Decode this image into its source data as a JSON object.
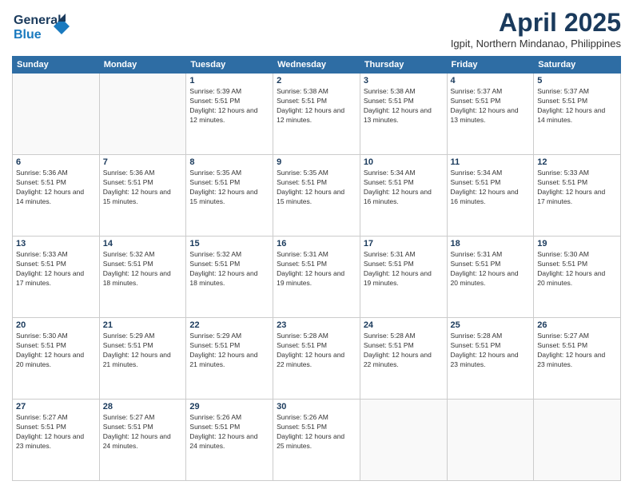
{
  "header": {
    "logo_line1": "General",
    "logo_line2": "Blue",
    "title": "April 2025",
    "subtitle": "Igpit, Northern Mindanao, Philippines"
  },
  "weekdays": [
    "Sunday",
    "Monday",
    "Tuesday",
    "Wednesday",
    "Thursday",
    "Friday",
    "Saturday"
  ],
  "weeks": [
    [
      {
        "day": "",
        "sunrise": "",
        "sunset": "",
        "daylight": ""
      },
      {
        "day": "",
        "sunrise": "",
        "sunset": "",
        "daylight": ""
      },
      {
        "day": "1",
        "sunrise": "Sunrise: 5:39 AM",
        "sunset": "Sunset: 5:51 PM",
        "daylight": "Daylight: 12 hours and 12 minutes."
      },
      {
        "day": "2",
        "sunrise": "Sunrise: 5:38 AM",
        "sunset": "Sunset: 5:51 PM",
        "daylight": "Daylight: 12 hours and 12 minutes."
      },
      {
        "day": "3",
        "sunrise": "Sunrise: 5:38 AM",
        "sunset": "Sunset: 5:51 PM",
        "daylight": "Daylight: 12 hours and 13 minutes."
      },
      {
        "day": "4",
        "sunrise": "Sunrise: 5:37 AM",
        "sunset": "Sunset: 5:51 PM",
        "daylight": "Daylight: 12 hours and 13 minutes."
      },
      {
        "day": "5",
        "sunrise": "Sunrise: 5:37 AM",
        "sunset": "Sunset: 5:51 PM",
        "daylight": "Daylight: 12 hours and 14 minutes."
      }
    ],
    [
      {
        "day": "6",
        "sunrise": "Sunrise: 5:36 AM",
        "sunset": "Sunset: 5:51 PM",
        "daylight": "Daylight: 12 hours and 14 minutes."
      },
      {
        "day": "7",
        "sunrise": "Sunrise: 5:36 AM",
        "sunset": "Sunset: 5:51 PM",
        "daylight": "Daylight: 12 hours and 15 minutes."
      },
      {
        "day": "8",
        "sunrise": "Sunrise: 5:35 AM",
        "sunset": "Sunset: 5:51 PM",
        "daylight": "Daylight: 12 hours and 15 minutes."
      },
      {
        "day": "9",
        "sunrise": "Sunrise: 5:35 AM",
        "sunset": "Sunset: 5:51 PM",
        "daylight": "Daylight: 12 hours and 15 minutes."
      },
      {
        "day": "10",
        "sunrise": "Sunrise: 5:34 AM",
        "sunset": "Sunset: 5:51 PM",
        "daylight": "Daylight: 12 hours and 16 minutes."
      },
      {
        "day": "11",
        "sunrise": "Sunrise: 5:34 AM",
        "sunset": "Sunset: 5:51 PM",
        "daylight": "Daylight: 12 hours and 16 minutes."
      },
      {
        "day": "12",
        "sunrise": "Sunrise: 5:33 AM",
        "sunset": "Sunset: 5:51 PM",
        "daylight": "Daylight: 12 hours and 17 minutes."
      }
    ],
    [
      {
        "day": "13",
        "sunrise": "Sunrise: 5:33 AM",
        "sunset": "Sunset: 5:51 PM",
        "daylight": "Daylight: 12 hours and 17 minutes."
      },
      {
        "day": "14",
        "sunrise": "Sunrise: 5:32 AM",
        "sunset": "Sunset: 5:51 PM",
        "daylight": "Daylight: 12 hours and 18 minutes."
      },
      {
        "day": "15",
        "sunrise": "Sunrise: 5:32 AM",
        "sunset": "Sunset: 5:51 PM",
        "daylight": "Daylight: 12 hours and 18 minutes."
      },
      {
        "day": "16",
        "sunrise": "Sunrise: 5:31 AM",
        "sunset": "Sunset: 5:51 PM",
        "daylight": "Daylight: 12 hours and 19 minutes."
      },
      {
        "day": "17",
        "sunrise": "Sunrise: 5:31 AM",
        "sunset": "Sunset: 5:51 PM",
        "daylight": "Daylight: 12 hours and 19 minutes."
      },
      {
        "day": "18",
        "sunrise": "Sunrise: 5:31 AM",
        "sunset": "Sunset: 5:51 PM",
        "daylight": "Daylight: 12 hours and 20 minutes."
      },
      {
        "day": "19",
        "sunrise": "Sunrise: 5:30 AM",
        "sunset": "Sunset: 5:51 PM",
        "daylight": "Daylight: 12 hours and 20 minutes."
      }
    ],
    [
      {
        "day": "20",
        "sunrise": "Sunrise: 5:30 AM",
        "sunset": "Sunset: 5:51 PM",
        "daylight": "Daylight: 12 hours and 20 minutes."
      },
      {
        "day": "21",
        "sunrise": "Sunrise: 5:29 AM",
        "sunset": "Sunset: 5:51 PM",
        "daylight": "Daylight: 12 hours and 21 minutes."
      },
      {
        "day": "22",
        "sunrise": "Sunrise: 5:29 AM",
        "sunset": "Sunset: 5:51 PM",
        "daylight": "Daylight: 12 hours and 21 minutes."
      },
      {
        "day": "23",
        "sunrise": "Sunrise: 5:28 AM",
        "sunset": "Sunset: 5:51 PM",
        "daylight": "Daylight: 12 hours and 22 minutes."
      },
      {
        "day": "24",
        "sunrise": "Sunrise: 5:28 AM",
        "sunset": "Sunset: 5:51 PM",
        "daylight": "Daylight: 12 hours and 22 minutes."
      },
      {
        "day": "25",
        "sunrise": "Sunrise: 5:28 AM",
        "sunset": "Sunset: 5:51 PM",
        "daylight": "Daylight: 12 hours and 23 minutes."
      },
      {
        "day": "26",
        "sunrise": "Sunrise: 5:27 AM",
        "sunset": "Sunset: 5:51 PM",
        "daylight": "Daylight: 12 hours and 23 minutes."
      }
    ],
    [
      {
        "day": "27",
        "sunrise": "Sunrise: 5:27 AM",
        "sunset": "Sunset: 5:51 PM",
        "daylight": "Daylight: 12 hours and 23 minutes."
      },
      {
        "day": "28",
        "sunrise": "Sunrise: 5:27 AM",
        "sunset": "Sunset: 5:51 PM",
        "daylight": "Daylight: 12 hours and 24 minutes."
      },
      {
        "day": "29",
        "sunrise": "Sunrise: 5:26 AM",
        "sunset": "Sunset: 5:51 PM",
        "daylight": "Daylight: 12 hours and 24 minutes."
      },
      {
        "day": "30",
        "sunrise": "Sunrise: 5:26 AM",
        "sunset": "Sunset: 5:51 PM",
        "daylight": "Daylight: 12 hours and 25 minutes."
      },
      {
        "day": "",
        "sunrise": "",
        "sunset": "",
        "daylight": ""
      },
      {
        "day": "",
        "sunrise": "",
        "sunset": "",
        "daylight": ""
      },
      {
        "day": "",
        "sunrise": "",
        "sunset": "",
        "daylight": ""
      }
    ]
  ]
}
